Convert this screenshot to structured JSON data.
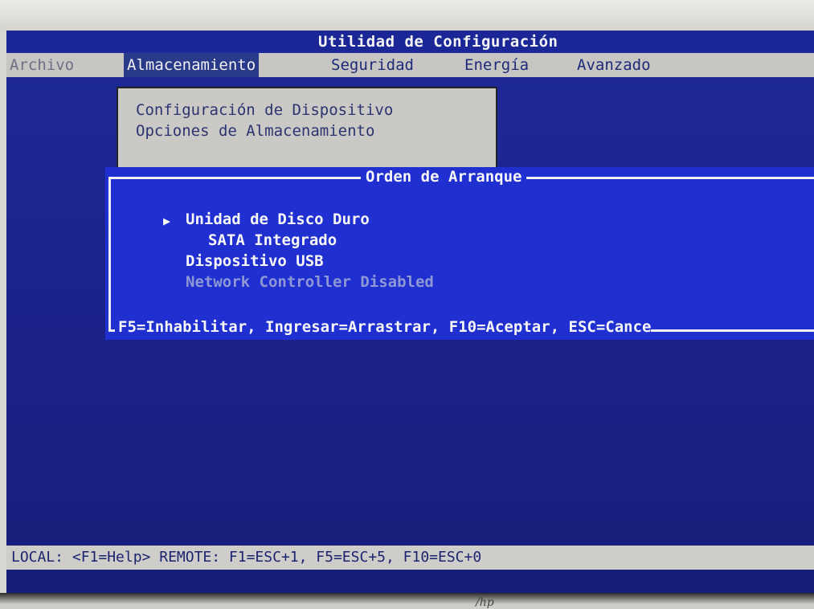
{
  "title": "Utilidad de Configuración",
  "menu": {
    "items": [
      {
        "label": "Archivo"
      },
      {
        "label": "Almacenamiento"
      },
      {
        "label": "Seguridad"
      },
      {
        "label": "Energía"
      },
      {
        "label": "Avanzado"
      }
    ]
  },
  "submenu": {
    "items": [
      {
        "label": "Configuración de Dispositivo"
      },
      {
        "label": "Opciones de Almacenamiento"
      }
    ]
  },
  "boot_order": {
    "title": "Orden de Arranque",
    "items": [
      {
        "label": "Unidad de Disco Duro"
      },
      {
        "label": "SATA Integrado"
      },
      {
        "label": "Dispositivo USB"
      },
      {
        "label": "Network Controller Disabled"
      }
    ],
    "selector_icon": "▶",
    "help": "F5=Inhabilitar, Ingresar=Arrastrar, F10=Aceptar, ESC=Cance"
  },
  "status_bar": {
    "text": "LOCAL: <F1=Help> REMOTE: F1=ESC+1, F5=ESC+5, F10=ESC+0"
  },
  "monitor_logo": "/hp",
  "colors": {
    "screen_blue": "#1a2288",
    "dialog_blue": "#1f2fd0",
    "menu_gray": "#c8c6c2",
    "disabled_text": "#8e98d4"
  }
}
